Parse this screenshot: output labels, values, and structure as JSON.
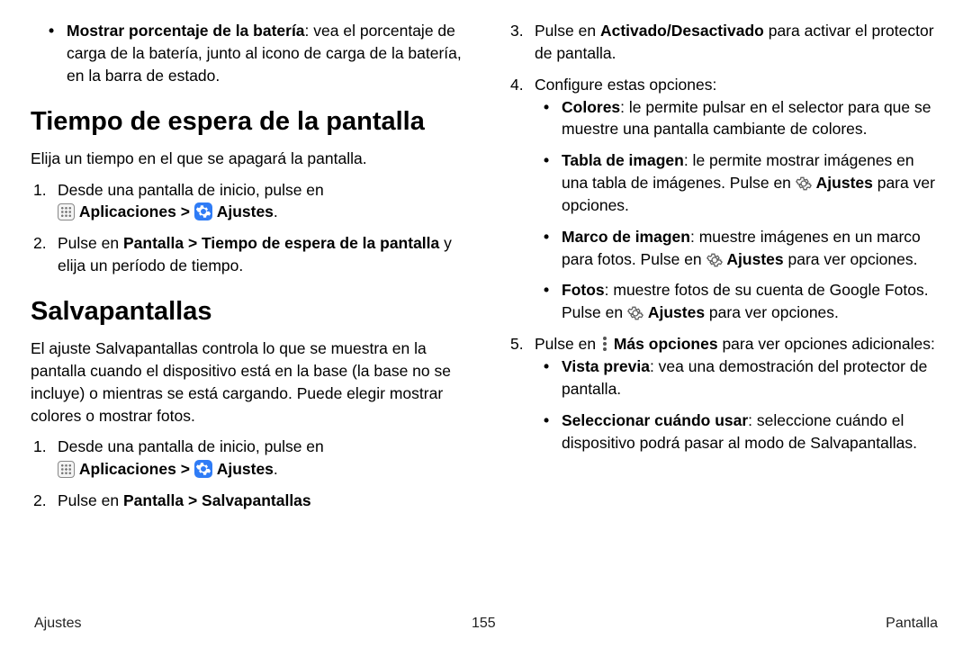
{
  "left": {
    "top_bullet": {
      "bold": "Mostrar porcentaje de la batería",
      "rest": ": vea el porcentaje de carga de la batería, junto al icono de carga de la batería, en la barra de estado."
    },
    "h_timeout": "Tiempo de espera de la pantalla",
    "timeout_intro": "Elija un tiempo en el que se apagará la pantalla.",
    "timeout_li1_a": "Desde una pantalla de inicio, pulse en",
    "apps_label": "Aplicaciones",
    "sep": " > ",
    "settings_label": "Ajustes",
    "timeout_li2_a": "Pulse en ",
    "timeout_li2_b": "Pantalla",
    "timeout_li2_c": " > ",
    "timeout_li2_d": "Tiempo de espera de la pantalla",
    "timeout_li2_e": " y elija un período de tiempo.",
    "h_saver": "Salvapantallas",
    "saver_intro": "El ajuste Salvapantallas controla lo que se muestra en la pantalla cuando el dispositivo está en la base (la base no se incluye) o mientras se está cargando. Puede elegir mostrar colores o mostrar fotos.",
    "saver_li1_a": "Desde una pantalla de inicio, pulse en",
    "saver_li2_a": "Pulse en ",
    "saver_li2_b": "Pantalla",
    "saver_li2_c": " > ",
    "saver_li2_d": "Salvapantallas"
  },
  "right": {
    "li3_a": "Pulse en ",
    "li3_b": "Activado/Desactivado",
    "li3_c": " para activar el protector de pantalla.",
    "li4": "Configure estas opciones:",
    "opt_colores_b": "Colores",
    "opt_colores_r": ": le permite pulsar en el selector para que se muestre una pantalla cambiante de colores.",
    "opt_tabla_b": "Tabla de imagen",
    "opt_tabla_r1": ": le permite mostrar imágenes en una tabla de imágenes. Pulse en ",
    "opt_tabla_r2": " para ver opciones.",
    "opt_marco_b": "Marco de imagen",
    "opt_marco_r1": ": muestre imágenes en un marco para fotos. Pulse en ",
    "opt_marco_r2": " para ver opciones.",
    "opt_fotos_b": "Fotos",
    "opt_fotos_r1": ": muestre fotos de su cuenta de Google Fotos. Pulse en ",
    "opt_fotos_r2": " para ver opciones.",
    "li5_a": "Pulse en ",
    "li5_b": "Más opciones",
    "li5_c": " para ver opciones adicionales:",
    "opt_vista_b": "Vista previa",
    "opt_vista_r": ": vea una demostración del protector de pantalla.",
    "opt_sel_b": "Seleccionar cuándo usar",
    "opt_sel_r": ": seleccione cuándo el dispositivo podrá pasar al modo de Salvapantallas.",
    "settings_inline": "Ajustes"
  },
  "footer": {
    "left": "Ajustes",
    "center": "155",
    "right": "Pantalla"
  },
  "numbers": {
    "n1": "1.",
    "n2": "2.",
    "n3": "3.",
    "n4": "4.",
    "n5": "5."
  },
  "period": "."
}
